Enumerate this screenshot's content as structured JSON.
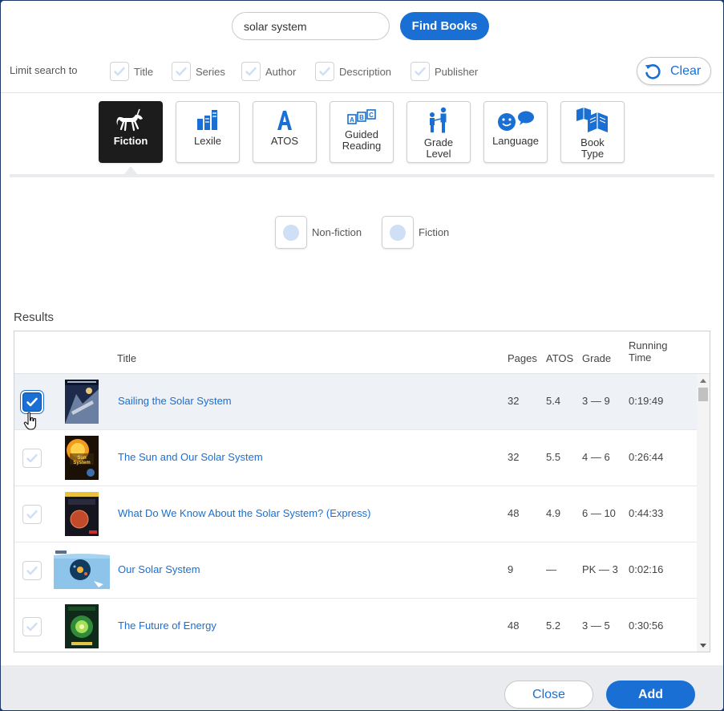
{
  "search": {
    "value": "solar system",
    "button_label": "Find Books"
  },
  "limit": {
    "label": "Limit search to",
    "options": [
      {
        "label": "Title",
        "checked": true
      },
      {
        "label": "Series",
        "checked": true
      },
      {
        "label": "Author",
        "checked": true
      },
      {
        "label": "Description",
        "checked": true
      },
      {
        "label": "Publisher",
        "checked": true
      }
    ],
    "clear_label": "Clear"
  },
  "filters": {
    "tiles": [
      {
        "label": "Fiction",
        "icon": "unicorn-icon",
        "active": true
      },
      {
        "label": "Lexile",
        "icon": "books-icon"
      },
      {
        "label": "ATOS",
        "icon": "letter-a-icon"
      },
      {
        "label": "Guided\nReading",
        "icon": "abc-blocks-icon"
      },
      {
        "label": "Grade\nLevel",
        "icon": "people-icon"
      },
      {
        "label": "Language",
        "icon": "speech-bubbles-icon"
      },
      {
        "label": "Book\nType",
        "icon": "open-books-icon"
      }
    ],
    "options": [
      {
        "label": "Non-fiction",
        "selected": false
      },
      {
        "label": "Fiction",
        "selected": false
      }
    ]
  },
  "results": {
    "label": "Results",
    "columns": {
      "title": "Title",
      "pages": "Pages",
      "atos": "ATOS",
      "grade": "Grade",
      "running_time_1": "Running",
      "running_time_2": "Time"
    },
    "rows": [
      {
        "title": "Sailing the Solar System",
        "pages": "32",
        "atos": "5.4",
        "grade": "3 — 9",
        "time": "0:19:49",
        "checked": true
      },
      {
        "title": "The Sun and Our Solar System",
        "pages": "32",
        "atos": "5.5",
        "grade": "4 — 6",
        "time": "0:26:44",
        "checked": false
      },
      {
        "title": "What Do We Know About the Solar System? (Express)",
        "pages": "48",
        "atos": "4.9",
        "grade": "6 — 10",
        "time": "0:44:33",
        "checked": false
      },
      {
        "title": "Our Solar System",
        "pages": "9",
        "atos": "—",
        "grade": "PK — 3",
        "time": "0:02:16",
        "checked": false
      },
      {
        "title": "The Future of Energy",
        "pages": "48",
        "atos": "5.2",
        "grade": "3 — 5",
        "time": "0:30:56",
        "checked": false
      }
    ]
  },
  "footer": {
    "close_label": "Close",
    "add_label": "Add"
  },
  "colors": {
    "accent": "#1a6fd4",
    "tile_active": "#1c1c1c",
    "selected_row": "#eef1f6",
    "footer_bg": "#e9ebef"
  }
}
